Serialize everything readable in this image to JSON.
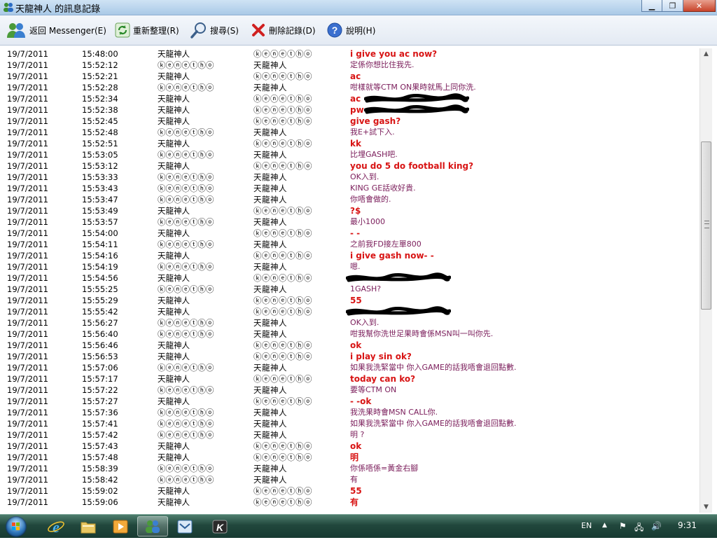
{
  "window": {
    "title": "天龍神人 的訊息記錄",
    "min_icon": "minimize-icon",
    "max_icon": "maximize-icon",
    "close_icon": "close-icon"
  },
  "toolbar": {
    "back_label": "返回 Messenger(E)",
    "reorder_label": "重新整理(R)",
    "search_label": "搜尋(S)",
    "delete_label": "刪除記錄(D)",
    "help_label": "說明(H)"
  },
  "log": {
    "rows": [
      {
        "date": "19/7/2011",
        "time": "15:48:00",
        "from": "天龍神人",
        "to": "ⓚⓔⓝⓔⓣⓗⓞ",
        "msg": "i give you ac now?",
        "style": "a"
      },
      {
        "date": "19/7/2011",
        "time": "15:52:12",
        "from": "ⓚⓔⓝⓔⓣⓗⓞ",
        "to": "天龍神人",
        "msg": "定係你想比住我先.",
        "style": "b"
      },
      {
        "date": "19/7/2011",
        "time": "15:52:21",
        "from": "天龍神人",
        "to": "ⓚⓔⓝⓔⓣⓗⓞ",
        "msg": "ac",
        "style": "a"
      },
      {
        "date": "19/7/2011",
        "time": "15:52:28",
        "from": "ⓚⓔⓝⓔⓣⓗⓞ",
        "to": "天龍神人",
        "msg": "咁樣就等CTM ON果時就馬上同你洗.",
        "style": "b"
      },
      {
        "date": "19/7/2011",
        "time": "15:52:34",
        "from": "天龍神人",
        "to": "ⓚⓔⓝⓔⓣⓗⓞ",
        "msg": "ac",
        "style": "a",
        "redact": true
      },
      {
        "date": "19/7/2011",
        "time": "15:52:38",
        "from": "天龍神人",
        "to": "ⓚⓔⓝⓔⓣⓗⓞ",
        "msg": "pw",
        "style": "a",
        "redact": true
      },
      {
        "date": "19/7/2011",
        "time": "15:52:45",
        "from": "天龍神人",
        "to": "ⓚⓔⓝⓔⓣⓗⓞ",
        "msg": "give gash?",
        "style": "a"
      },
      {
        "date": "19/7/2011",
        "time": "15:52:48",
        "from": "ⓚⓔⓝⓔⓣⓗⓞ",
        "to": "天龍神人",
        "msg": "我E+試下入.",
        "style": "b"
      },
      {
        "date": "19/7/2011",
        "time": "15:52:51",
        "from": "天龍神人",
        "to": "ⓚⓔⓝⓔⓣⓗⓞ",
        "msg": "kk",
        "style": "a"
      },
      {
        "date": "19/7/2011",
        "time": "15:53:05",
        "from": "ⓚⓔⓝⓔⓣⓗⓞ",
        "to": "天龍神人",
        "msg": "比埋GASH吧.",
        "style": "b"
      },
      {
        "date": "19/7/2011",
        "time": "15:53:12",
        "from": "天龍神人",
        "to": "ⓚⓔⓝⓔⓣⓗⓞ",
        "msg": "you do 5 do football king?",
        "style": "a"
      },
      {
        "date": "19/7/2011",
        "time": "15:53:33",
        "from": "ⓚⓔⓝⓔⓣⓗⓞ",
        "to": "天龍神人",
        "msg": "OK入到.",
        "style": "b"
      },
      {
        "date": "19/7/2011",
        "time": "15:53:43",
        "from": "ⓚⓔⓝⓔⓣⓗⓞ",
        "to": "天龍神人",
        "msg": "KING GE話收好貴.",
        "style": "b"
      },
      {
        "date": "19/7/2011",
        "time": "15:53:47",
        "from": "ⓚⓔⓝⓔⓣⓗⓞ",
        "to": "天龍神人",
        "msg": "你唔會做的.",
        "style": "b"
      },
      {
        "date": "19/7/2011",
        "time": "15:53:49",
        "from": "天龍神人",
        "to": "ⓚⓔⓝⓔⓣⓗⓞ",
        "msg": "?$",
        "style": "a"
      },
      {
        "date": "19/7/2011",
        "time": "15:53:57",
        "from": "ⓚⓔⓝⓔⓣⓗⓞ",
        "to": "天龍神人",
        "msg": "最小1000",
        "style": "b"
      },
      {
        "date": "19/7/2011",
        "time": "15:54:00",
        "from": "天龍神人",
        "to": "ⓚⓔⓝⓔⓣⓗⓞ",
        "msg": "- -",
        "style": "a"
      },
      {
        "date": "19/7/2011",
        "time": "15:54:11",
        "from": "ⓚⓔⓝⓔⓣⓗⓞ",
        "to": "天龍神人",
        "msg": "之前我FD接左單800",
        "style": "b"
      },
      {
        "date": "19/7/2011",
        "time": "15:54:16",
        "from": "天龍神人",
        "to": "ⓚⓔⓝⓔⓣⓗⓞ",
        "msg": "i give gash now- -",
        "style": "a"
      },
      {
        "date": "19/7/2011",
        "time": "15:54:19",
        "from": "ⓚⓔⓝⓔⓣⓗⓞ",
        "to": "天龍神人",
        "msg": "嗯.",
        "style": "b"
      },
      {
        "date": "19/7/2011",
        "time": "15:54:56",
        "from": "天龍神人",
        "to": "ⓚⓔⓝⓔⓣⓗⓞ",
        "msg": "",
        "style": "a",
        "redact": true
      },
      {
        "date": "19/7/2011",
        "time": "15:55:25",
        "from": "ⓚⓔⓝⓔⓣⓗⓞ",
        "to": "天龍神人",
        "msg": "1GASH?",
        "style": "b"
      },
      {
        "date": "19/7/2011",
        "time": "15:55:29",
        "from": "天龍神人",
        "to": "ⓚⓔⓝⓔⓣⓗⓞ",
        "msg": "55",
        "style": "a"
      },
      {
        "date": "19/7/2011",
        "time": "15:55:42",
        "from": "天龍神人",
        "to": "ⓚⓔⓝⓔⓣⓗⓞ",
        "msg": "",
        "style": "a",
        "redact": true
      },
      {
        "date": "19/7/2011",
        "time": "15:56:27",
        "from": "ⓚⓔⓝⓔⓣⓗⓞ",
        "to": "天龍神人",
        "msg": "OK入到.",
        "style": "b"
      },
      {
        "date": "19/7/2011",
        "time": "15:56:40",
        "from": "ⓚⓔⓝⓔⓣⓗⓞ",
        "to": "天龍神人",
        "msg": "咁我幫你洗世足果時會係MSN叫一叫你先.",
        "style": "b"
      },
      {
        "date": "19/7/2011",
        "time": "15:56:46",
        "from": "天龍神人",
        "to": "ⓚⓔⓝⓔⓣⓗⓞ",
        "msg": "ok",
        "style": "a"
      },
      {
        "date": "19/7/2011",
        "time": "15:56:53",
        "from": "天龍神人",
        "to": "ⓚⓔⓝⓔⓣⓗⓞ",
        "msg": "i play sin ok?",
        "style": "a"
      },
      {
        "date": "19/7/2011",
        "time": "15:57:06",
        "from": "ⓚⓔⓝⓔⓣⓗⓞ",
        "to": "天龍神人",
        "msg": "如果我洗緊當中 你入GAME的話我唔會退回點數.",
        "style": "b"
      },
      {
        "date": "19/7/2011",
        "time": "15:57:17",
        "from": "天龍神人",
        "to": "ⓚⓔⓝⓔⓣⓗⓞ",
        "msg": "today can ko?",
        "style": "a"
      },
      {
        "date": "19/7/2011",
        "time": "15:57:22",
        "from": "ⓚⓔⓝⓔⓣⓗⓞ",
        "to": "天龍神人",
        "msg": "要等CTM ON",
        "style": "b"
      },
      {
        "date": "19/7/2011",
        "time": "15:57:27",
        "from": "天龍神人",
        "to": "ⓚⓔⓝⓔⓣⓗⓞ",
        "msg": "- -ok",
        "style": "a"
      },
      {
        "date": "19/7/2011",
        "time": "15:57:36",
        "from": "ⓚⓔⓝⓔⓣⓗⓞ",
        "to": "天龍神人",
        "msg": "我洗果時會MSN CALL你.",
        "style": "b"
      },
      {
        "date": "19/7/2011",
        "time": "15:57:41",
        "from": "ⓚⓔⓝⓔⓣⓗⓞ",
        "to": "天龍神人",
        "msg": "如果我洗緊當中 你入GAME的話我唔會退回點數.",
        "style": "b"
      },
      {
        "date": "19/7/2011",
        "time": "15:57:42",
        "from": "ⓚⓔⓝⓔⓣⓗⓞ",
        "to": "天龍神人",
        "msg": "明 ?",
        "style": "b"
      },
      {
        "date": "19/7/2011",
        "time": "15:57:43",
        "from": "天龍神人",
        "to": "ⓚⓔⓝⓔⓣⓗⓞ",
        "msg": "ok",
        "style": "a"
      },
      {
        "date": "19/7/2011",
        "time": "15:57:48",
        "from": "天龍神人",
        "to": "ⓚⓔⓝⓔⓣⓗⓞ",
        "msg": "明",
        "style": "a"
      },
      {
        "date": "19/7/2011",
        "time": "15:58:39",
        "from": "ⓚⓔⓝⓔⓣⓗⓞ",
        "to": "天龍神人",
        "msg": "你係唔係=黃金右腳",
        "style": "b"
      },
      {
        "date": "19/7/2011",
        "time": "15:58:42",
        "from": "ⓚⓔⓝⓔⓣⓗⓞ",
        "to": "天龍神人",
        "msg": "有",
        "style": "b"
      },
      {
        "date": "19/7/2011",
        "time": "15:59:02",
        "from": "天龍神人",
        "to": "ⓚⓔⓝⓔⓣⓗⓞ",
        "msg": "55",
        "style": "a"
      },
      {
        "date": "19/7/2011",
        "time": "15:59:06",
        "from": "天龍神人",
        "to": "ⓚⓔⓝⓔⓣⓗⓞ",
        "msg": "有",
        "style": "a"
      }
    ]
  },
  "taskbar": {
    "lang": "EN",
    "clock": "9:31",
    "apps": [
      "internet-explorer-icon",
      "explorer-folder-icon",
      "media-player-icon",
      "messenger-history-icon",
      "outlook-icon",
      "game-k-icon"
    ]
  },
  "colors": {
    "msg_a": "#d81414",
    "msg_b": "#7a1c5a"
  }
}
